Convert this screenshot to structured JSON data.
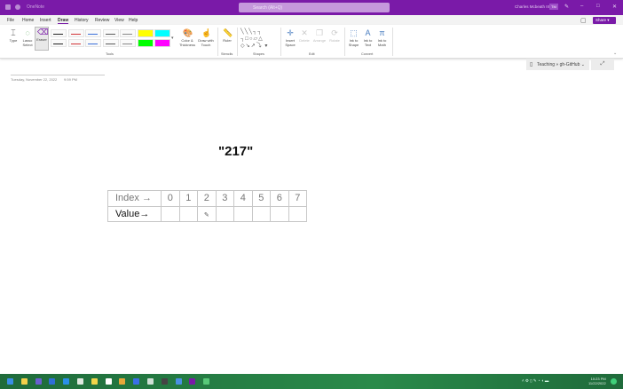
{
  "titlebar": {
    "app_name": "OneNote",
    "search_placeholder": "Search (Alt+Q)",
    "user": "Charles Mcbeath III",
    "user_badge": "TM"
  },
  "menu": [
    "File",
    "Home",
    "Insert",
    "Draw",
    "History",
    "Review",
    "View",
    "Help"
  ],
  "active_menu": "Draw",
  "share_label": "Share",
  "ribbon": {
    "tools": {
      "type": "Type",
      "lasso": "Lasso Select",
      "eraser": "Eraser",
      "color": "Color & Thickness",
      "touch": "Draw with Touch",
      "group": "Tools"
    },
    "pen_colors": [
      "#222222",
      "#d13438",
      "#3a6fd8",
      "#5a5a5a",
      "#888888",
      "#222222",
      "#d13438",
      "#3a6fd8",
      "#5a5a5a",
      "#888888"
    ],
    "highlighters": [
      "#ffff00",
      "#00ffff",
      "#00ff00",
      "#ff00ff"
    ],
    "stencils": {
      "ruler": "Ruler",
      "group": "Stencils"
    },
    "shapes": {
      "group": "Shapes"
    },
    "edit": {
      "insert_space": "Insert Space",
      "delete": "Delete",
      "arrange": "Arrange",
      "rotate": "Rotate",
      "group": "Edit"
    },
    "convert": {
      "ink_shape": "Ink to Shape",
      "ink_text": "Ink to Text",
      "ink_math": "Ink to Math",
      "group": "Convert"
    }
  },
  "notebook": "Teaching » gh-GitHub",
  "page": {
    "date": "Tuesday, November 22, 2022",
    "time": "9:59 PM",
    "title_text": "\"217\"",
    "table": {
      "row1_label": "Index →",
      "row2_label": "Value→",
      "indices": [
        "0",
        "1",
        "2",
        "3",
        "4",
        "5",
        "6",
        "7"
      ]
    }
  },
  "taskbar": {
    "time": "10:23 PM",
    "date": "11/22/2022"
  }
}
